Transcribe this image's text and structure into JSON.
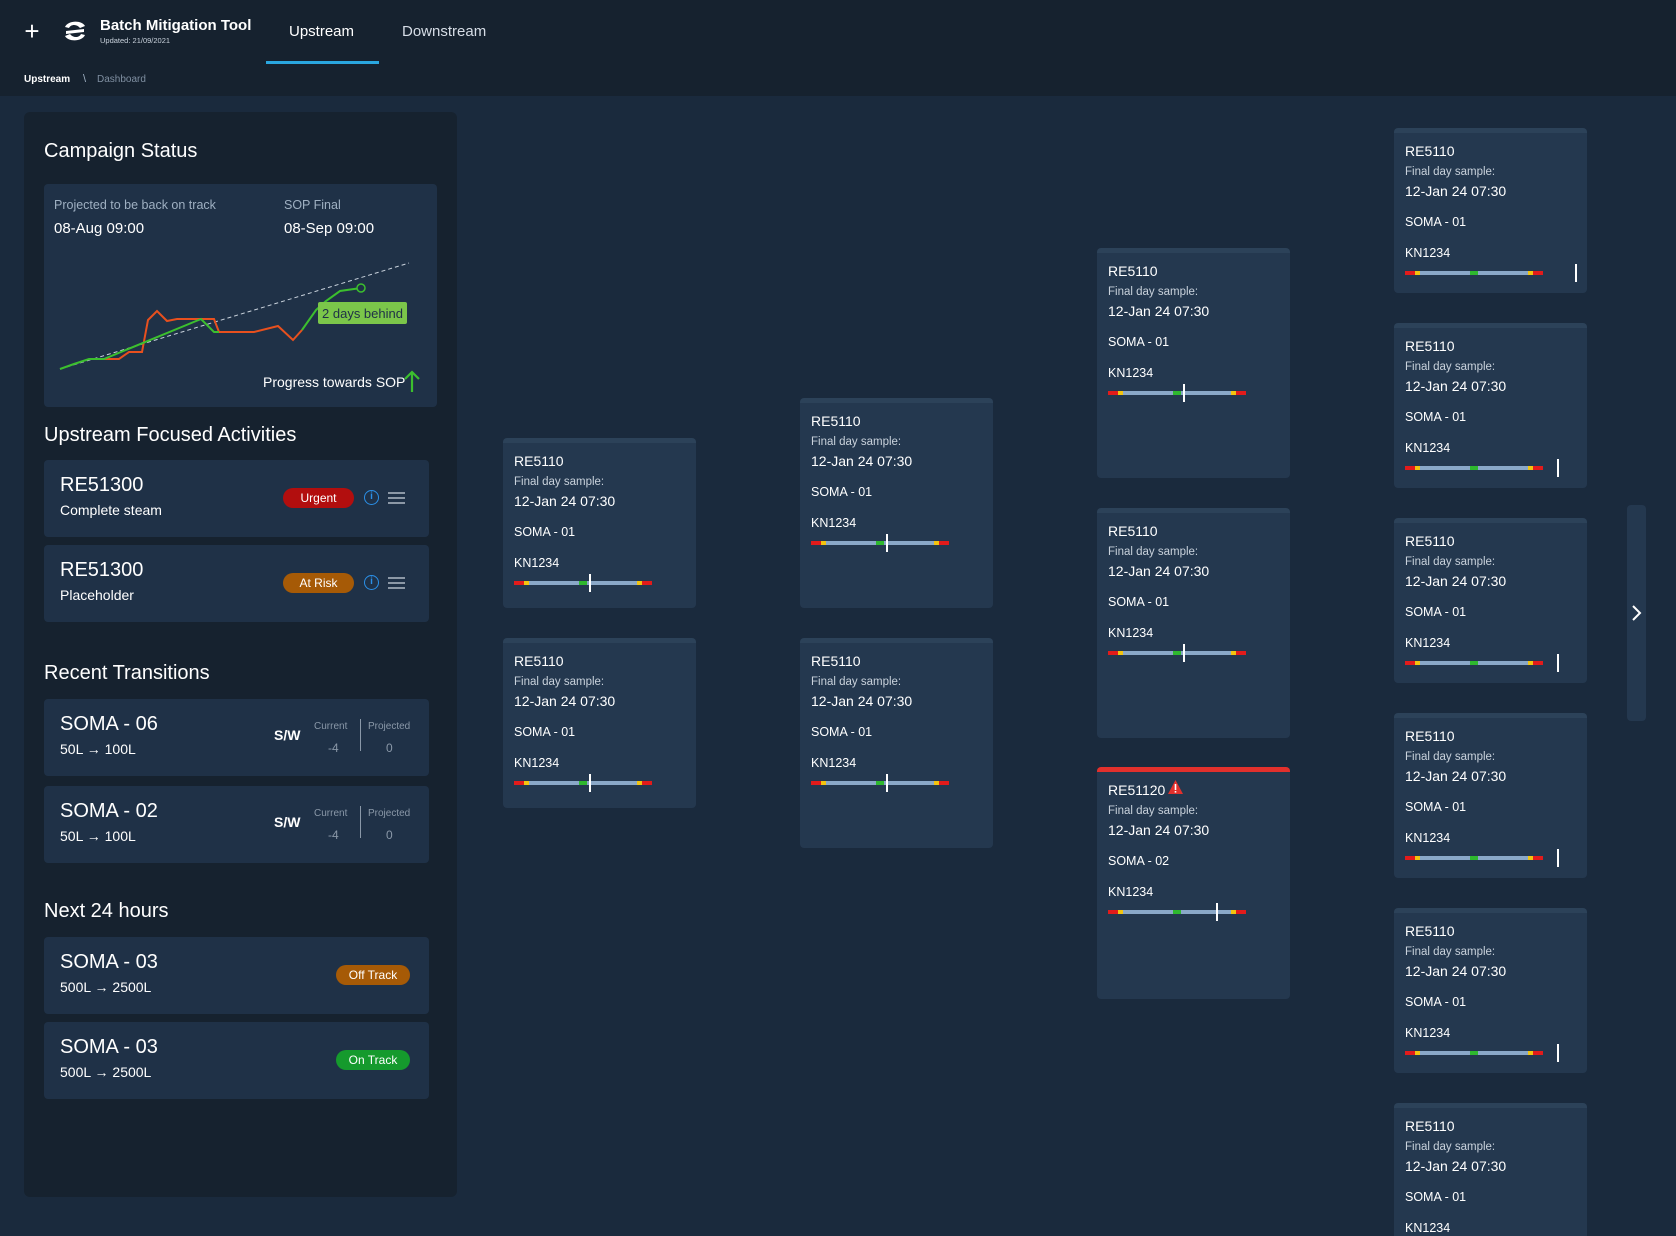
{
  "header": {
    "app_title": "Batch Mitigation Tool",
    "updated": "Updated: 21/09/2021",
    "tabs": [
      {
        "label": "Upstream",
        "active": true
      },
      {
        "label": "Downstream",
        "active": false
      }
    ],
    "accent_color": "#2aa7e0"
  },
  "breadcrumb": {
    "root": "Upstream",
    "separator": "\\",
    "current": "Dashboard"
  },
  "campaign": {
    "title": "Campaign Status",
    "projected_label": "Projected to be back on track",
    "projected_value": "08-Aug 09:00",
    "sop_label": "SOP Final",
    "sop_value": "08-Sep 09:00",
    "behind_label": "2 days behind",
    "progress_label": "Progress towards SOP"
  },
  "focused": {
    "title": "Upstream Focused Activities",
    "items": [
      {
        "id": "RE51300",
        "desc": "Complete steam",
        "badge": "Urgent",
        "badge_color": "#b20e0e"
      },
      {
        "id": "RE51300",
        "desc": "Placeholder",
        "badge": "At Risk",
        "badge_color": "#a65a06"
      }
    ]
  },
  "transitions": {
    "title": "Recent Transitions",
    "items": [
      {
        "name": "SOMA - 06",
        "volume": "50L → 100L",
        "type": "S/W",
        "current_label": "Current",
        "current": "-4",
        "projected_label": "Projected",
        "projected": "0"
      },
      {
        "name": "SOMA - 02",
        "volume": "50L → 100L",
        "type": "S/W",
        "current_label": "Current",
        "current": "-4",
        "projected_label": "Projected",
        "projected": "0"
      }
    ]
  },
  "next24": {
    "title": "Next 24 hours",
    "items": [
      {
        "name": "SOMA - 03",
        "volume": "500L → 2500L",
        "badge": "Off Track",
        "badge_color": "#a65a06"
      },
      {
        "name": "SOMA - 03",
        "volume": "500L → 2500L",
        "badge": "On Track",
        "badge_color": "#159a2d"
      }
    ]
  },
  "batches": [
    {
      "id": "RE5110",
      "label": "Final day sample:",
      "date": "12-Jan 24 07:30",
      "soma": "SOMA - 01",
      "kn": "KN1234",
      "alert": false
    },
    {
      "id": "RE5110",
      "label": "Final day sample:",
      "date": "12-Jan 24 07:30",
      "soma": "SOMA - 01",
      "kn": "KN1234",
      "alert": false
    },
    {
      "id": "RE5110",
      "label": "Final day sample:",
      "date": "12-Jan 24 07:30",
      "soma": "SOMA - 01",
      "kn": "KN1234",
      "alert": false
    },
    {
      "id": "RE5110",
      "label": "Final day sample:",
      "date": "12-Jan 24 07:30",
      "soma": "SOMA - 01",
      "kn": "KN1234",
      "alert": false
    },
    {
      "id": "RE5110",
      "label": "Final day sample:",
      "date": "12-Jan 24 07:30",
      "soma": "SOMA - 01",
      "kn": "KN1234",
      "alert": false
    },
    {
      "id": "RE5110",
      "label": "Final day sample:",
      "date": "12-Jan 24 07:30",
      "soma": "SOMA - 01",
      "kn": "KN1234",
      "alert": false
    },
    {
      "id": "RE51120",
      "label": "Final day sample:",
      "date": "12-Jan 24 07:30",
      "soma": "SOMA - 02",
      "kn": "KN1234",
      "alert": true
    },
    {
      "id": "RE5110",
      "label": "Final day sample:",
      "date": "12-Jan 24 07:30",
      "soma": "SOMA - 01",
      "kn": "KN1234",
      "alert": false
    },
    {
      "id": "RE5110",
      "label": "Final day sample:",
      "date": "12-Jan 24 07:30",
      "soma": "SOMA - 01",
      "kn": "KN1234",
      "alert": false
    },
    {
      "id": "RE5110",
      "label": "Final day sample:",
      "date": "12-Jan 24 07:30",
      "soma": "SOMA - 01",
      "kn": "KN1234",
      "alert": false
    },
    {
      "id": "RE5110",
      "label": "Final day sample:",
      "date": "12-Jan 24 07:30",
      "soma": "SOMA - 01",
      "kn": "KN1234",
      "alert": false
    },
    {
      "id": "RE5110",
      "label": "Final day sample:",
      "date": "12-Jan 24 07:30",
      "soma": "SOMA - 01",
      "kn": "KN1234",
      "alert": false
    },
    {
      "id": "RE5110",
      "label": "Final day sample:",
      "date": "12-Jan 24 07:30",
      "soma": "SOMA - 01",
      "kn": "KN1234",
      "alert": false
    }
  ],
  "icons": {
    "add": "plus-icon",
    "logo": "brand-logo-icon",
    "info": "info-icon",
    "menu": "drag-handle-icon",
    "warning": "warning-icon",
    "next": "chevron-right-icon",
    "up": "arrow-up-icon"
  }
}
